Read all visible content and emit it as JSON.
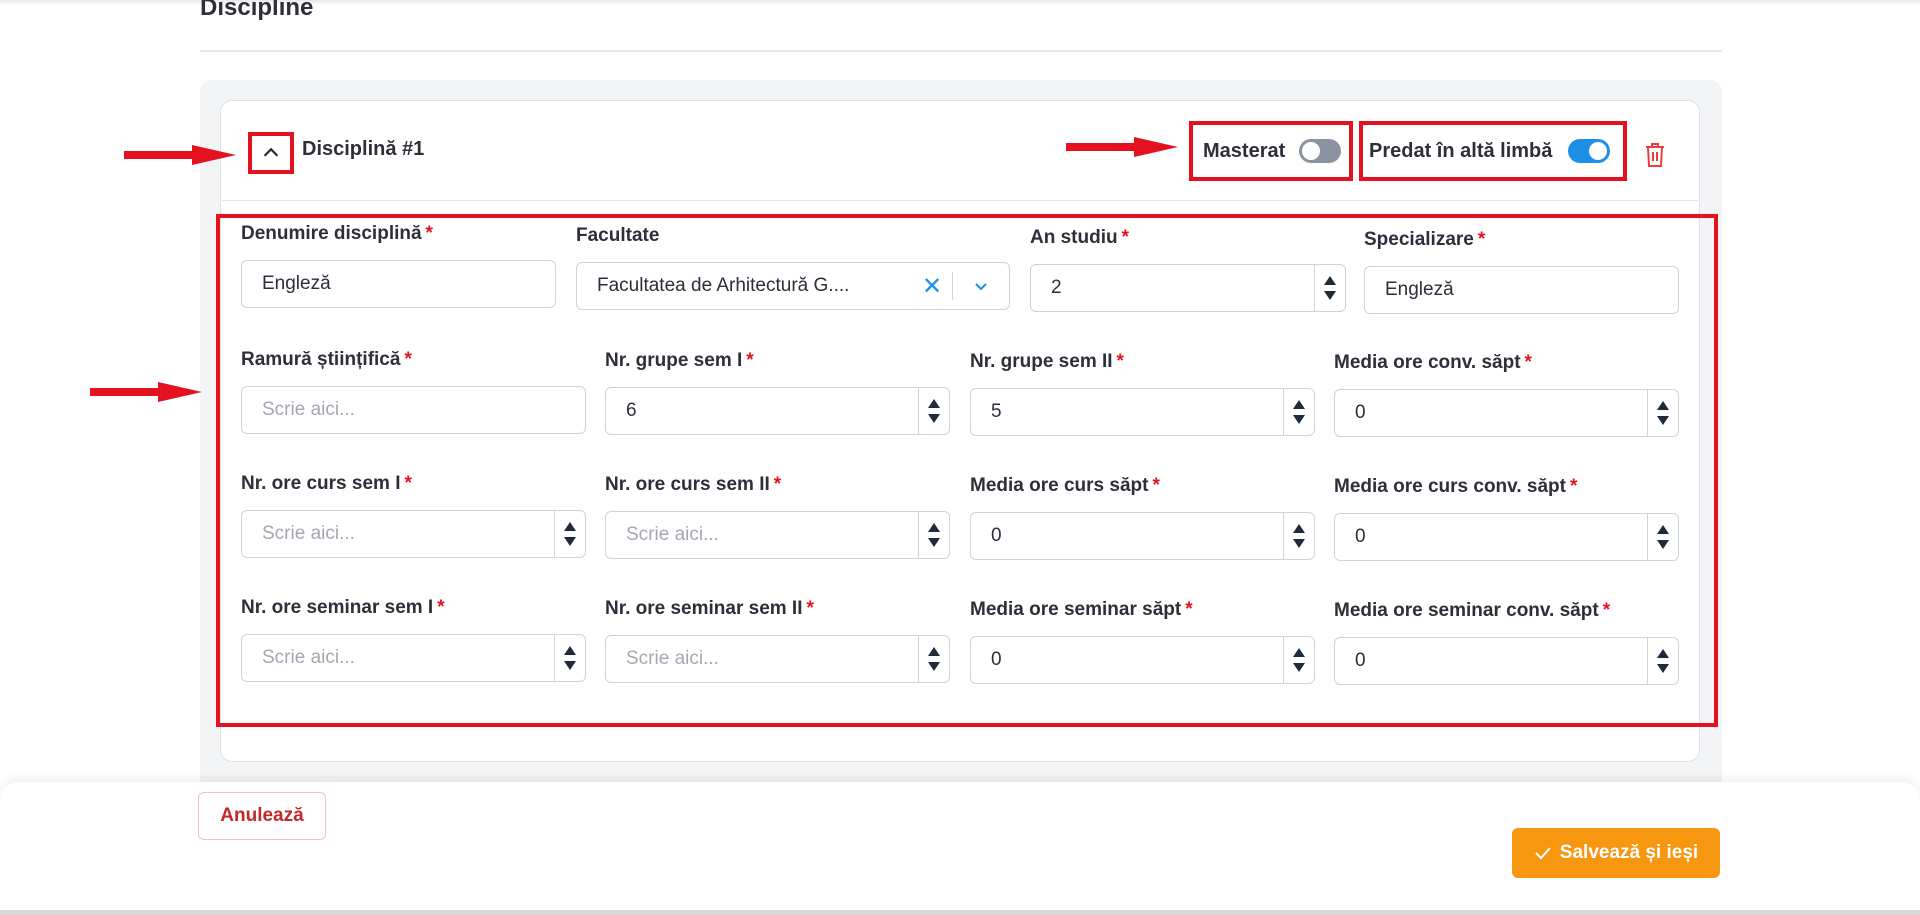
{
  "section": {
    "title": "Discipline"
  },
  "discipline": {
    "title": "Disciplină #1",
    "toggles": {
      "masterat": {
        "label": "Masterat",
        "on": false
      },
      "other_language": {
        "label": "Predat în altă limbă",
        "on": true
      }
    }
  },
  "colors": {
    "annotation": "#e3121e",
    "accent": "#1e8fe6",
    "primary_button": "#f7960f",
    "required": "#e3121e"
  },
  "icons": {
    "collapse": "chevron-up-icon",
    "delete": "trash-icon",
    "clear": "close-icon",
    "dropdown": "chevron-down-icon",
    "save": "check-icon"
  },
  "form": {
    "row1": {
      "denumire": {
        "label": "Denumire disciplină",
        "value": "Engleză"
      },
      "facultate": {
        "label": "Facultate",
        "value": "Facultatea de Arhitectură G...."
      },
      "an_studiu": {
        "label": "An studiu",
        "value": "2"
      },
      "specializare": {
        "label": "Specializare",
        "value": "Engleză"
      }
    },
    "row2": {
      "ramura": {
        "label": "Ramură științifică",
        "placeholder": "Scrie aici..."
      },
      "grupe_sem1": {
        "label": "Nr. grupe sem I",
        "value": "6"
      },
      "grupe_sem2": {
        "label": "Nr. grupe sem II",
        "value": "5"
      },
      "media_conv": {
        "label": "Media ore conv. săpt",
        "value": "0"
      }
    },
    "row3": {
      "curs_sem1": {
        "label": "Nr. ore curs sem I",
        "placeholder": "Scrie aici..."
      },
      "curs_sem2": {
        "label": "Nr. ore curs sem II",
        "placeholder": "Scrie aici..."
      },
      "media_curs": {
        "label": "Media ore curs săpt",
        "value": "0"
      },
      "media_curs_conv": {
        "label": "Media ore curs conv. săpt",
        "value": "0"
      }
    },
    "row4": {
      "seminar_sem1": {
        "label": "Nr. ore seminar sem I",
        "placeholder": "Scrie aici..."
      },
      "seminar_sem2": {
        "label": "Nr. ore seminar sem II",
        "placeholder": "Scrie aici..."
      },
      "media_seminar": {
        "label": "Media ore seminar săpt",
        "value": "0"
      },
      "media_seminar_conv": {
        "label": "Media ore seminar conv. săpt",
        "value": "0"
      }
    }
  },
  "footer": {
    "cancel_label": "Anulează",
    "save_label": "Salvează și ieși"
  }
}
